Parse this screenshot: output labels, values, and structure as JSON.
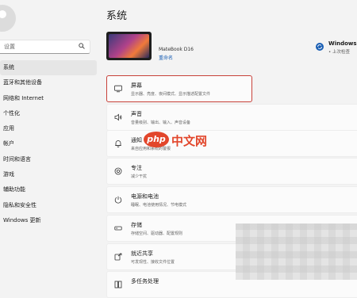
{
  "sidebar": {
    "search_placeholder": "设置",
    "items": [
      {
        "label": "系统",
        "active": true
      },
      {
        "label": "蓝牙和其他设备"
      },
      {
        "label": "网络和 Internet"
      },
      {
        "label": "个性化"
      },
      {
        "label": "应用"
      },
      {
        "label": "帐户"
      },
      {
        "label": "时间和语言"
      },
      {
        "label": "游戏"
      },
      {
        "label": "辅助功能"
      },
      {
        "label": "隐私和安全性"
      },
      {
        "label": "Windows 更新"
      }
    ]
  },
  "main": {
    "title": "系统",
    "device": {
      "name": "MateBook D16",
      "rename": "重命名"
    },
    "windows_update": {
      "title": "Windows 更",
      "subtitle": "• 上次检查"
    },
    "cards": [
      {
        "title": "屏幕",
        "subtitle": "显示器、亮度、夜间模式、显示描述配置文件",
        "icon": "monitor-icon"
      },
      {
        "title": "声音",
        "subtitle": "音量级别、输出、输入、声音设备",
        "icon": "speaker-icon"
      },
      {
        "title": "通知",
        "subtitle": "来自应用和系统的警报",
        "icon": "bell-icon"
      },
      {
        "title": "专注",
        "subtitle": "减少干扰",
        "icon": "focus-icon"
      },
      {
        "title": "电源和电池",
        "subtitle": "睡眠、电池使用情况、节电模式",
        "icon": "power-icon"
      },
      {
        "title": "存储",
        "subtitle": "存储空间、驱动器、配置规则",
        "icon": "storage-icon"
      },
      {
        "title": "就近共享",
        "subtitle": "可发现性、接收文件位置",
        "icon": "share-icon"
      },
      {
        "title": "多任务处理",
        "subtitle": "",
        "icon": "multitask-icon"
      }
    ]
  },
  "watermark": {
    "badge": "php",
    "text": "中文网"
  },
  "colors": {
    "accent": "#1a5fb4",
    "highlight_border": "#c8413a",
    "watermark": "#e2462b"
  }
}
